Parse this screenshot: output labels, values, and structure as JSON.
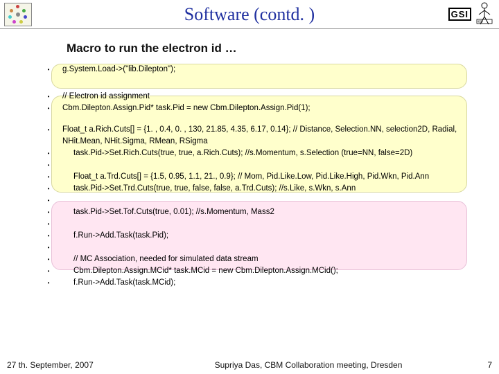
{
  "header": {
    "title": "Software (contd. )",
    "gsi_label": "GSI"
  },
  "subtitle": "Macro to run the electron id …",
  "code": {
    "l0": "g.System.Load->(\"lib.Dilepton\");",
    "l1": "// Electron id assignment",
    "l2": "Cbm.Dilepton.Assign.Pid* task.Pid = new Cbm.Dilepton.Assign.Pid(1);",
    "l3": "Float_t a.Rich.Cuts[] = {1. , 0.4, 0. , 130, 21.85, 4.35, 6.17, 0.14}; // Distance, Selection.NN, selection2D, Radial, NHit.Mean, NHit.Sigma, RMean, RSigma",
    "l4": "task.Pid->Set.Rich.Cuts(true, true, a.Rich.Cuts); //s.Momentum, s.Selection (true=NN, false=2D)",
    "l5": "Float_t a.Trd.Cuts[] = {1.5, 0.95, 1.1, 21., 0.9}; // Mom, Pid.Like.Low, Pid.Like.High, Pid.Wkn, Pid.Ann",
    "l6": "task.Pid->Set.Trd.Cuts(true, true, false, false, a.Trd.Cuts); //s.Like, s.Wkn, s.Ann",
    "l7": "task.Pid->Set.Tof.Cuts(true, 0.01); //s.Momentum, Mass2",
    "l8": "f.Run->Add.Task(task.Pid);",
    "l9": "// MC Association, needed for simulated data stream",
    "l10": "Cbm.Dilepton.Assign.MCid* task.MCid = new Cbm.Dilepton.Assign.MCid();",
    "l11": "f.Run->Add.Task(task.MCid);"
  },
  "footer": {
    "date": "27 th. September, 2007",
    "center": "Supriya Das, CBM Collaboration meeting, Dresden",
    "page": "7"
  }
}
